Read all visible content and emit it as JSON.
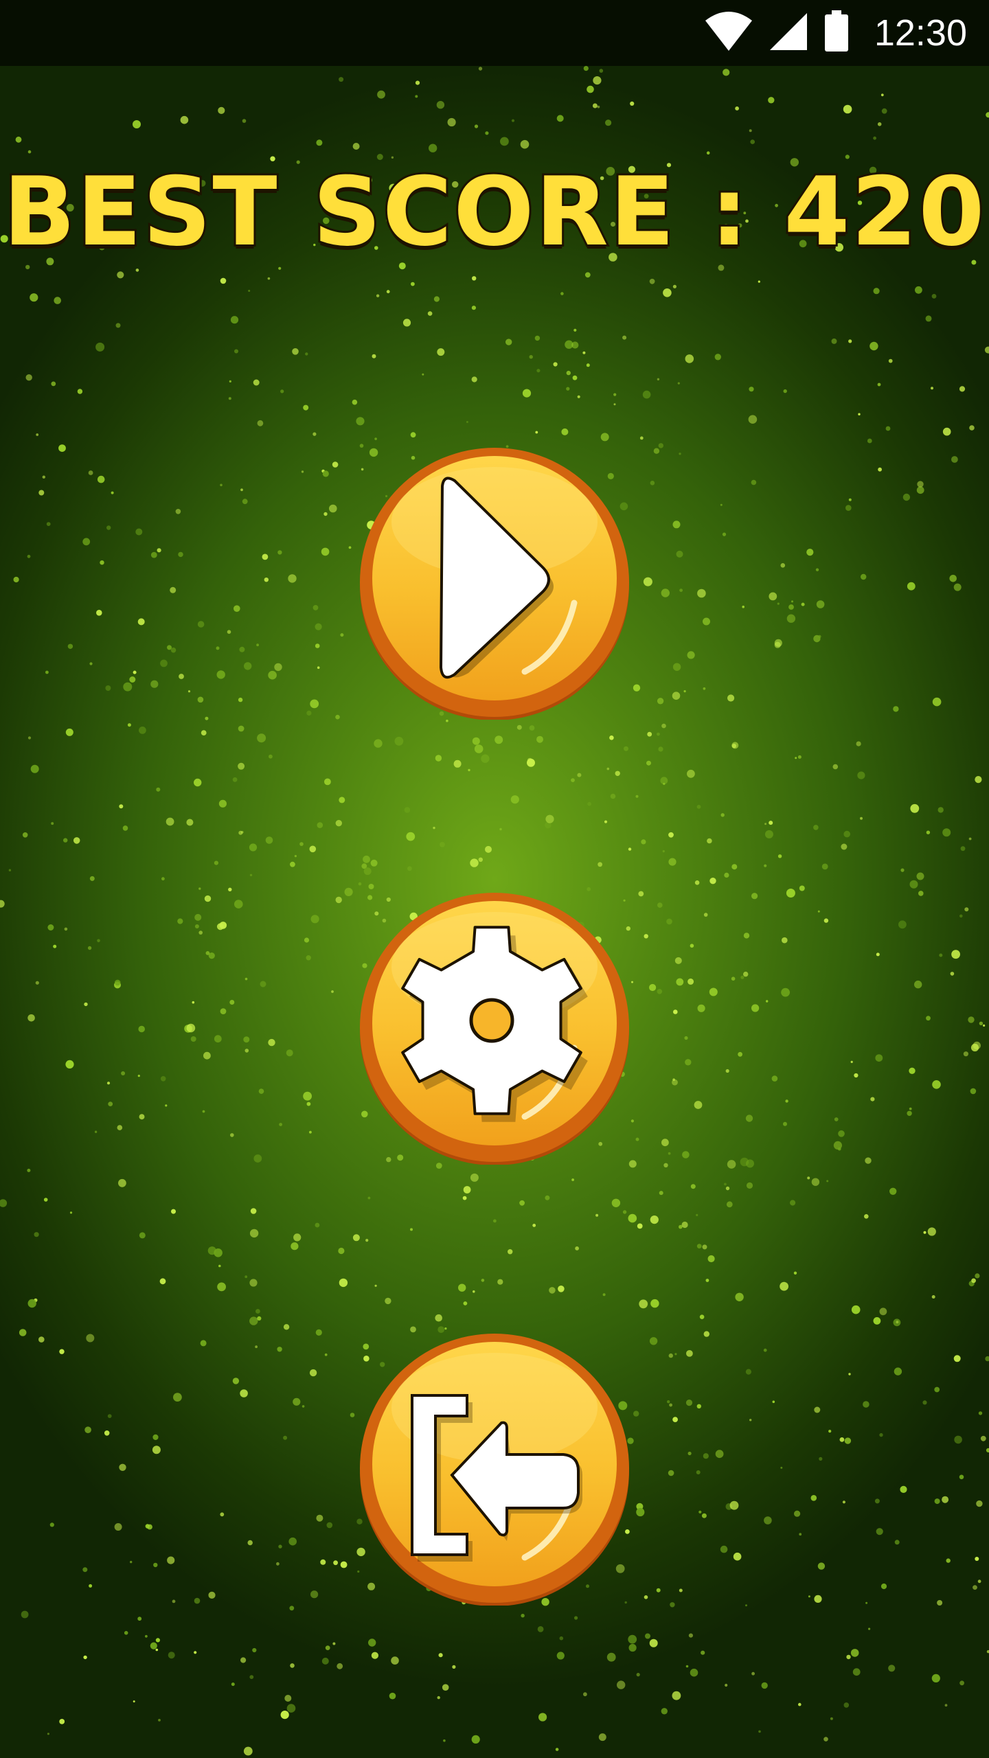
{
  "status_bar": {
    "time": "12:30",
    "icons": [
      "wifi-icon",
      "cellular-signal-icon",
      "battery-icon"
    ]
  },
  "title": {
    "best_score_text": "BEST SCORE : 420"
  },
  "menu": {
    "buttons": [
      {
        "name": "play-button",
        "icon": "play-icon"
      },
      {
        "name": "settings-button",
        "icon": "gear-icon"
      },
      {
        "name": "exit-button",
        "icon": "exit-icon"
      }
    ]
  },
  "colors": {
    "title_fill": "#ffdf3a",
    "title_outline": "#1d1300",
    "button_fill": "#f7b52a",
    "button_rim": "#c8540e",
    "background": "#4f8410"
  }
}
